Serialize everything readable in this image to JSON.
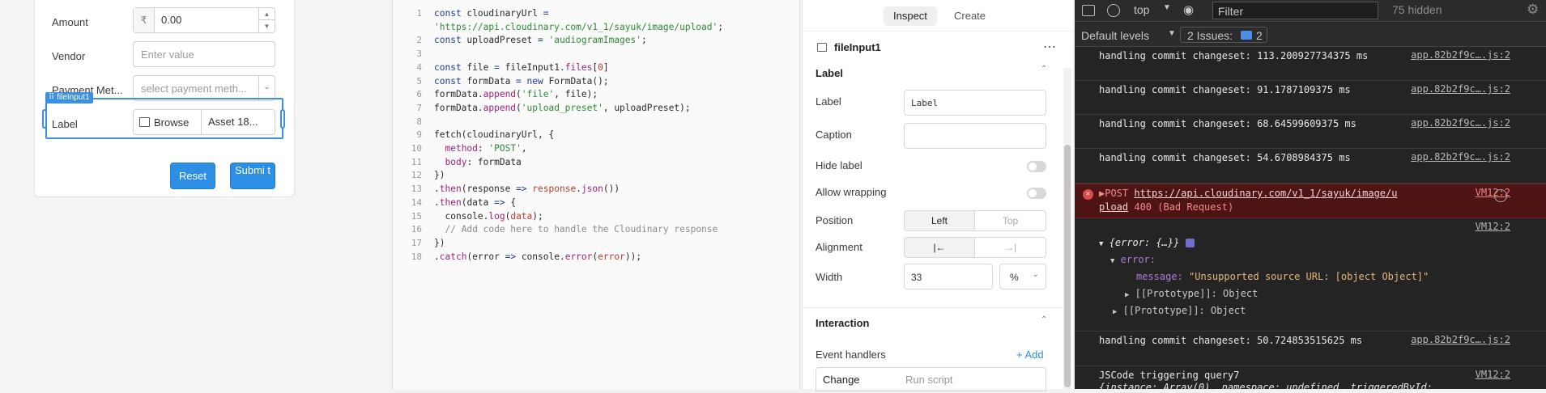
{
  "form": {
    "amount_label": "Amount",
    "amount_currency": "₹",
    "amount_value": "0.00",
    "vendor_label": "Vendor",
    "vendor_placeholder": "Enter value",
    "payment_label": "Payment Met...",
    "payment_placeholder": "select payment meth...",
    "selected_tag": "⠿ fileInput1",
    "label_label": "Label",
    "browse_label": "Browse",
    "file_name": "Asset 18...",
    "reset_label": "Reset",
    "submit_label": "Submi t"
  },
  "editor": {
    "lines": [
      {
        "n": "1",
        "html": "<span class='kw'>const</span> cloudinaryUrl <span class='kw'>=</span>"
      },
      {
        "n": "",
        "html": "<span class='str'>'https://api.cloudinary.com/v1_1/sayuk/image/upload'</span>;"
      },
      {
        "n": "2",
        "html": "<span class='kw'>const</span> uploadPreset <span class='kw'>=</span> <span class='str'>'audiogramImages'</span>;"
      },
      {
        "n": "3",
        "html": ""
      },
      {
        "n": "4",
        "html": "<span class='kw'>const</span> file <span class='kw'>=</span> fileInput1.<span class='prop'>files</span>[<span class='num'>0</span>]"
      },
      {
        "n": "5",
        "html": "<span class='kw'>const</span> formData <span class='kw'>=</span> <span class='kw'>new</span> FormData();"
      },
      {
        "n": "6",
        "html": "formData.<span class='prop'>append</span>(<span class='str'>'file'</span>, file);"
      },
      {
        "n": "7",
        "html": "formData.<span class='prop'>append</span>(<span class='str'>'upload_preset'</span>, uploadPreset);"
      },
      {
        "n": "8",
        "html": ""
      },
      {
        "n": "9",
        "html": "fetch(cloudinaryUrl, {"
      },
      {
        "n": "10",
        "html": "  <span class='prop'>method</span>: <span class='str'>'POST'</span>,"
      },
      {
        "n": "11",
        "html": "  <span class='prop'>body</span>: formData"
      },
      {
        "n": "12",
        "html": "})"
      },
      {
        "n": "13",
        "html": ".<span class='prop'>then</span>(response <span class='kw'>=&gt;</span> <span class='var'>response</span>.<span class='prop'>json</span>())"
      },
      {
        "n": "14",
        "html": ".<span class='prop'>then</span>(data <span class='kw'>=&gt;</span> {"
      },
      {
        "n": "15",
        "html": "  console.<span class='prop'>log</span>(<span class='var'>data</span>);"
      },
      {
        "n": "16",
        "html": "  <span class='cm'>// Add code here to handle the Cloudinary response</span>"
      },
      {
        "n": "17",
        "html": "})"
      },
      {
        "n": "18",
        "html": ".<span class='prop'>catch</span>(error <span class='kw'>=&gt;</span> console.<span class='prop'>error</span>(<span class='var'>error</span>));"
      }
    ]
  },
  "inspector": {
    "tab_inspect": "Inspect",
    "tab_create": "Create",
    "component_name": "fileInput1",
    "more": "⋯",
    "section_label": "Label",
    "label_label": "Label",
    "label_value": "Label",
    "caption_label": "Caption",
    "hide_label_label": "Hide label",
    "allow_wrapping_label": "Allow wrapping",
    "position_label": "Position",
    "position_left": "Left",
    "position_top": "Top",
    "alignment_label": "Alignment",
    "align_left_glyph": "|←",
    "align_right_glyph": "→|",
    "width_label": "Width",
    "width_value": "33",
    "width_unit": "%",
    "section_interaction": "Interaction",
    "event_handlers_label": "Event handlers",
    "add_label": "+ Add",
    "event_change": "Change",
    "event_action": "Run script"
  },
  "devtools": {
    "context": "top",
    "filter_placeholder": "Filter",
    "hidden_count": "75 hidden",
    "levels": "Default levels",
    "issues_label": "2 Issues:",
    "issues_count": "2",
    "messages": [
      {
        "text": "handling commit changeset: 113.200927734375 ms",
        "src": "app.82b2f9c….js:2"
      },
      {
        "text": "handling commit changeset: 91.1787109375 ms",
        "src": "app.82b2f9c….js:2"
      },
      {
        "text": "handling commit changeset: 68.64599609375 ms",
        "src": "app.82b2f9c….js:2"
      },
      {
        "text": "handling commit changeset: 54.6708984375 ms",
        "src": "app.82b2f9c….js:2"
      }
    ],
    "error": {
      "method": "▶POST",
      "url": "https://api.cloudinary.com/v1_1/sayuk/image/upload",
      "status": "400 (Bad Request)",
      "src": "VM12:2"
    },
    "obj_src": "VM12:2",
    "obj_summary": "{error: {…}}",
    "obj_key": "error:",
    "obj_message_key": "message:",
    "obj_message_val": "\"Unsupported source URL: [object Object]\"",
    "proto1": "[[Prototype]]: Object",
    "proto2": "[[Prototype]]: Object",
    "last_msg": {
      "text": "handling commit changeset: 50.724853515625 ms",
      "src": "app.82b2f9c….js:2"
    },
    "js_msg": {
      "text": "JSCode triggering query7",
      "src": "VM12:2"
    },
    "js_obj": "{instance: Array(0), namespace: undefined, triggeredById:"
  }
}
